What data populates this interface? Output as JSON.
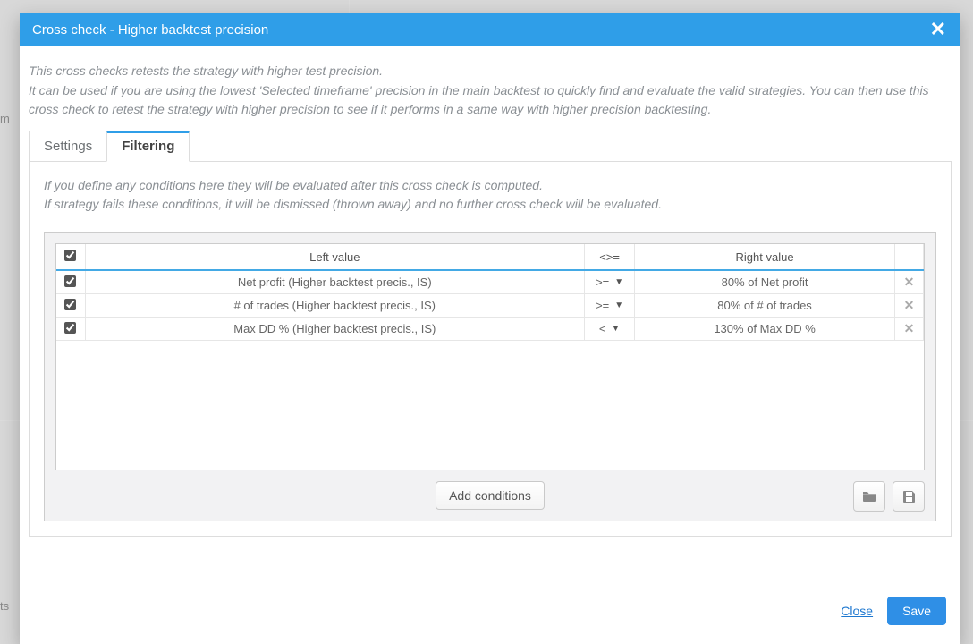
{
  "modal": {
    "title": "Cross check - Higher backtest precision",
    "intro_l1": "This cross checks retests the strategy with higher test precision.",
    "intro_l2": "It can be used if you are using the lowest 'Selected timeframe' precision in the main backtest to quickly find and evaluate the valid strategies. You can then use this cross check to retest the strategy with higher precision to see if it performs in a same way with higher precision backtesting.",
    "tabs": {
      "settings": "Settings",
      "filtering": "Filtering"
    },
    "panel_hint_l1": "If you define any conditions here they will be evaluated after this cross check is computed.",
    "panel_hint_l2": "If strategy fails these conditions, it will be dismissed (thrown away) and no further cross check will be evaluated.",
    "columns": {
      "left": "Left value",
      "op": "<>=",
      "right": "Right value"
    },
    "rows": [
      {
        "checked": true,
        "left": "Net profit (Higher backtest precis., IS)",
        "op": ">=",
        "right": "80% of Net profit"
      },
      {
        "checked": true,
        "left": "# of trades (Higher backtest precis., IS)",
        "op": ">=",
        "right": "80% of # of trades"
      },
      {
        "checked": true,
        "left": "Max DD % (Higher backtest precis., IS)",
        "op": "<",
        "right": "130% of Max DD %"
      }
    ],
    "add_conditions": "Add conditions",
    "footer": {
      "close": "Close",
      "save": "Save"
    }
  }
}
